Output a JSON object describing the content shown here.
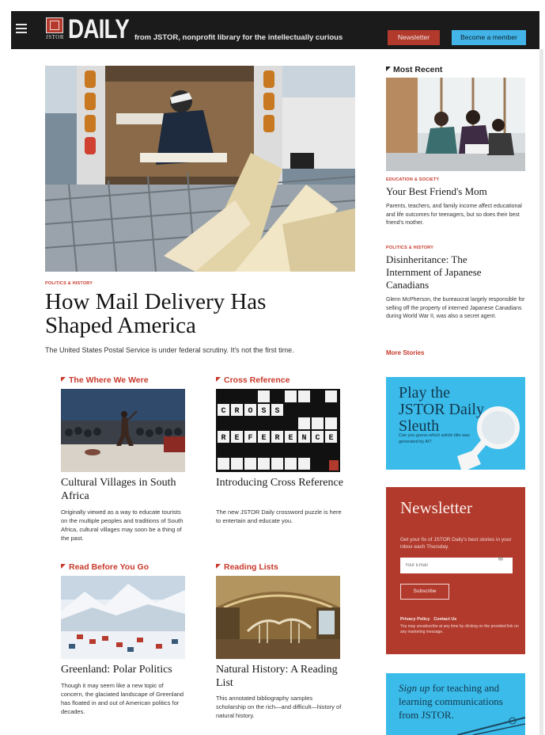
{
  "header": {
    "logo_text": "DAILY",
    "logo_sub": "JSTOR",
    "tagline": "from JSTOR, nonprofit library for the intellectually curious",
    "newsletter_button": "Newsletter",
    "member_button": "Become a member"
  },
  "hero": {
    "kicker": "POLITICS & HISTORY",
    "title_line1": "How Mail Delivery Has",
    "title_line2": "Shaped America",
    "dek": "The United States Postal Service is under federal scrutiny. It's not the first time."
  },
  "most_recent": {
    "section_title": "Most Recent",
    "items": [
      {
        "kicker": "EDUCATION & SOCIETY",
        "title": "Your Best Friend's Mom",
        "blurb": "Parents, teachers, and family income affect educational and life outcomes for teenagers, but so does their best friend's mother."
      },
      {
        "kicker": "POLITICS & HISTORY",
        "title": "Disinheritance: The Internment of Japanese Canadians",
        "blurb": "Glenn McPherson, the bureaucrat largely responsible for selling off the property of interned Japanese Canadians during World War II, was also a secret agent."
      }
    ],
    "more_link": "More Stories"
  },
  "sleuth": {
    "title": "Play the JSTOR Daily Sleuth",
    "subtitle": "Can you guess which article title was generated by AI?"
  },
  "newsletter": {
    "title": "Newsletter",
    "subtitle": "Get your fix of JSTOR Daily's best stories in your inbox each Thursday.",
    "input_placeholder": "Your Email",
    "button": "Subscribe",
    "privacy_link": "Privacy Policy",
    "contact_link": "Contact Us",
    "fine_print": "You may unsubscribe at any time by clicking on the provided link on any marketing message."
  },
  "signup": {
    "lead": "Sign up",
    "text": " for teaching and learning communications from JSTOR."
  },
  "grid": [
    {
      "section": "The Where We Were",
      "title": "Cultural Villages in South Africa",
      "blurb": "Originally viewed as a way to educate tourists on the multiple peoples and traditions of South Africa, cultural villages may soon be a thing of the past."
    },
    {
      "section": "Cross Reference",
      "title": "Introducing Cross Reference",
      "blurb": "The new JSTOR Daily crossword puzzle is here to entertain and educate you.",
      "cross_word": "CROSS",
      "ref_word": "REFERENCE"
    },
    {
      "section": "Read Before You Go",
      "title": "Greenland: Polar Politics",
      "blurb": "Though it may seem like a new topic of concern, the glaciated landscape of Greenland has floated in and out of American politics for decades."
    },
    {
      "section": "Reading Lists",
      "title": "Natural History: A Reading List",
      "blurb": "This annotated bibliography samples scholarship on the rich—and difficult—history of natural history."
    }
  ],
  "colors": {
    "accent_red": "#b13a2d",
    "accent_blue": "#3bbbe9",
    "header_bg": "#1b1b1b"
  },
  "icons": [
    "hamburger-menu-icon",
    "section-arrow-icon",
    "magnifying-glass-icon",
    "mail-icon"
  ]
}
